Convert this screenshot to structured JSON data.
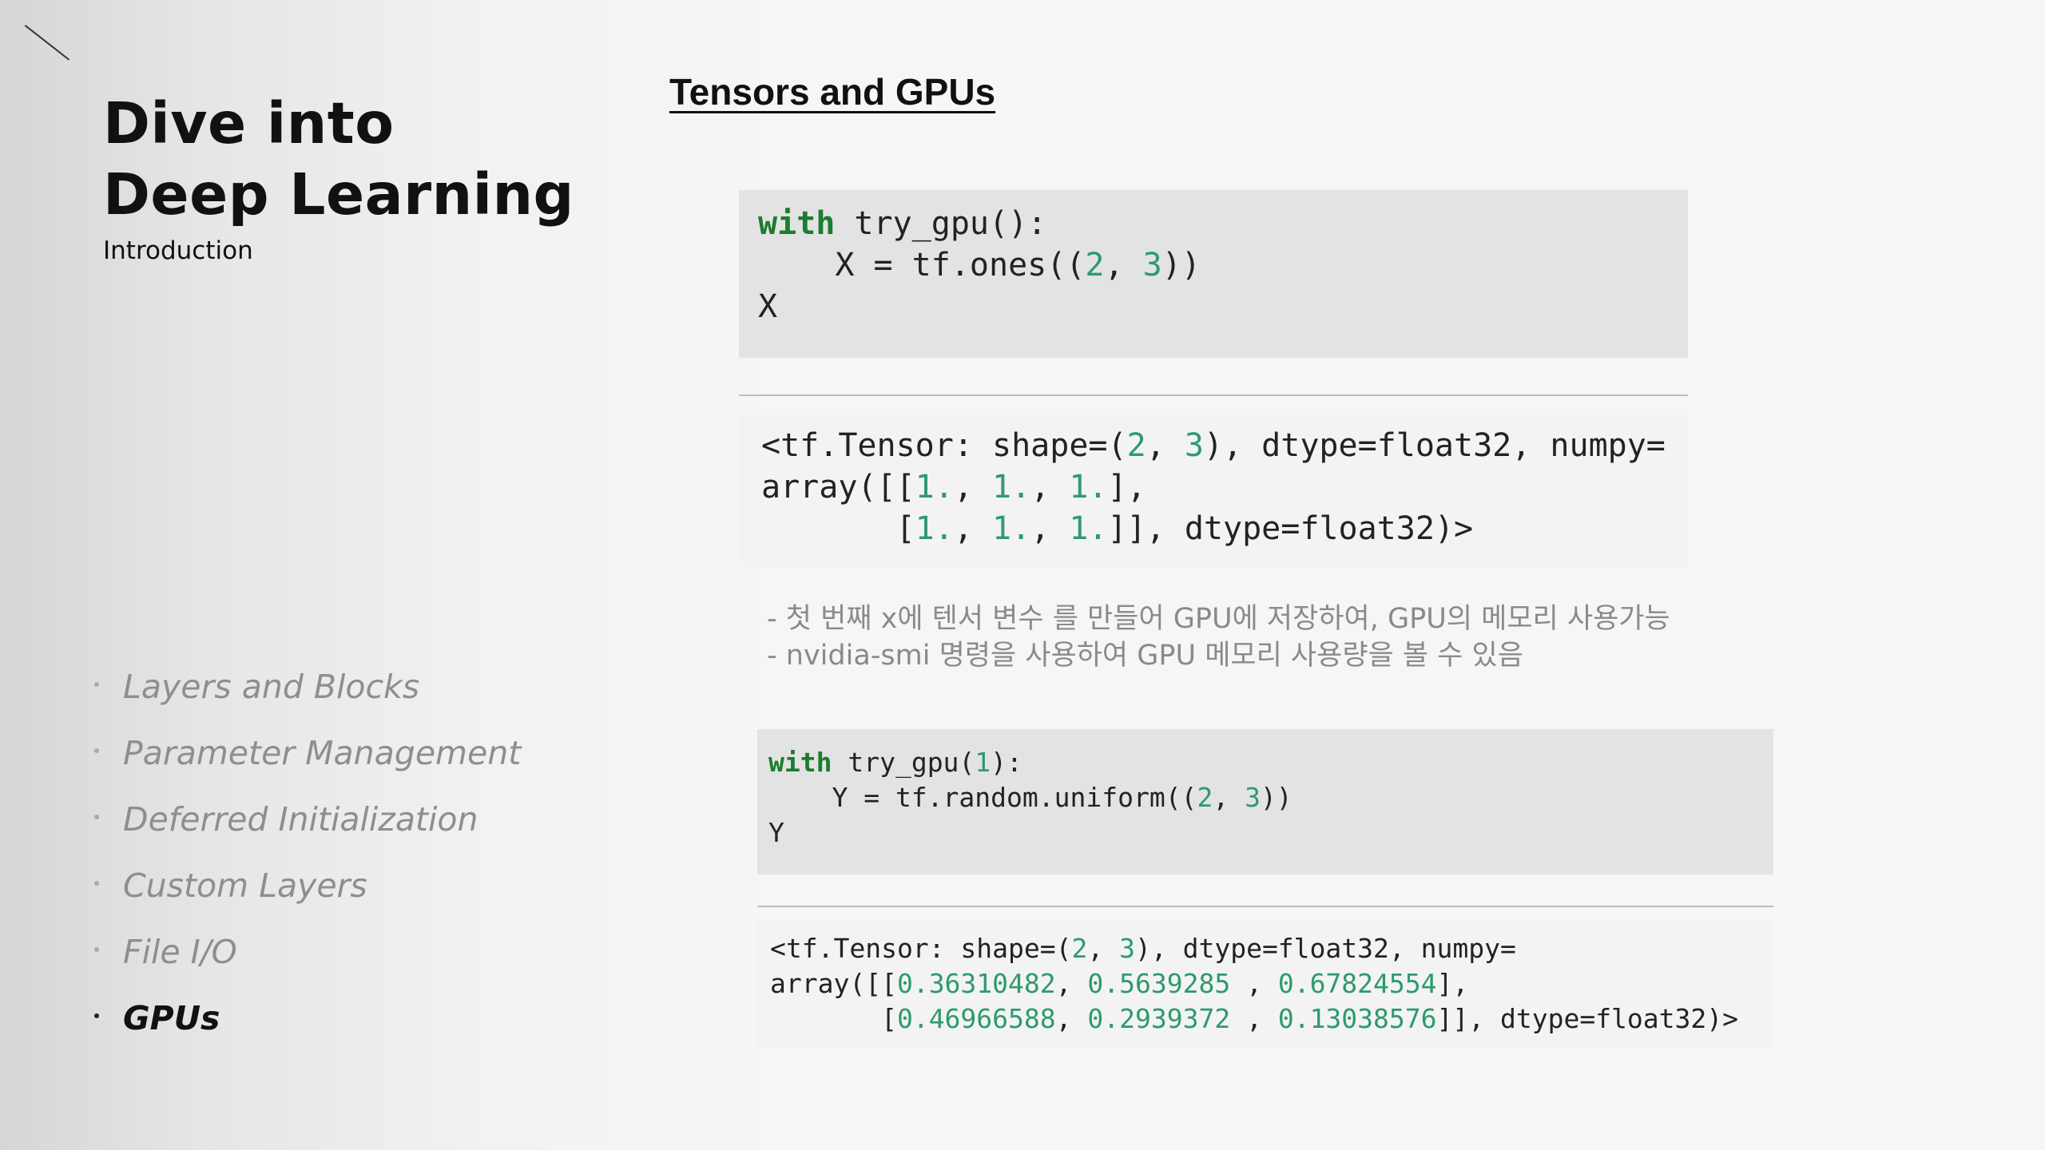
{
  "sidebar": {
    "title_line1": "Dive into",
    "title_line2": "Deep Learning",
    "subtitle": "Introduction",
    "nav_items": [
      {
        "label": "Layers and Blocks"
      },
      {
        "label": "Parameter Management"
      },
      {
        "label": "Deferred Initialization"
      },
      {
        "label": "Custom Layers"
      },
      {
        "label": "File I/O"
      },
      {
        "label": "GPUs"
      }
    ],
    "active_item": "GPUs"
  },
  "slide": {
    "heading": "Tensors and GPUs",
    "code1": {
      "l1_kw": "with",
      "l1_rest": " try_gpu():",
      "l2_a": "    X = tf.ones((",
      "l2_n1": "2",
      "l2_b": ", ",
      "l2_n2": "3",
      "l2_c": "))",
      "l3": "X"
    },
    "output1": {
      "l1_a": "<tf.Tensor: shape=(",
      "l1_n1": "2",
      "l1_b": ", ",
      "l1_n2": "3",
      "l1_c": "), dtype=float32, numpy=",
      "l2_a": "array([[",
      "l2_n1": "1.",
      "l2_b": ", ",
      "l2_n2": "1.",
      "l2_c": ", ",
      "l2_n3": "1.",
      "l2_d": "],",
      "l3_a": "       [",
      "l3_n1": "1.",
      "l3_b": ", ",
      "l3_n2": "1.",
      "l3_c": ", ",
      "l3_n3": "1.",
      "l3_d": "]], dtype=float32)>"
    },
    "notes": [
      "- 첫 번째 x에 텐서 변수 를 만들어 GPU에 저장하여, GPU의 메모리 사용가능",
      "-  nvidia-smi 명령을 사용하여 GPU 메모리 사용량을 볼 수 있음"
    ],
    "code2": {
      "l1_kw": "with",
      "l1_a": " try_gpu(",
      "l1_n": "1",
      "l1_b": "):",
      "l2_a": "    Y = tf.random.uniform((",
      "l2_n1": "2",
      "l2_b": ", ",
      "l2_n2": "3",
      "l2_c": "))",
      "l3": "Y"
    },
    "output2": {
      "l1_a": "<tf.Tensor: shape=(",
      "l1_n1": "2",
      "l1_b": ", ",
      "l1_n2": "3",
      "l1_c": "), dtype=float32, numpy=",
      "l2_a": "array([[",
      "l2_n1": "0.36310482",
      "l2_b": ", ",
      "l2_n2": "0.5639285 ",
      "l2_c": ", ",
      "l2_n3": "0.67824554",
      "l2_d": "],",
      "l3_a": "       [",
      "l3_n1": "0.46966588",
      "l3_b": ", ",
      "l3_n2": "0.2939372 ",
      "l3_c": ", ",
      "l3_n3": "0.13038576",
      "l3_d": "]], dtype=float32)>"
    }
  }
}
